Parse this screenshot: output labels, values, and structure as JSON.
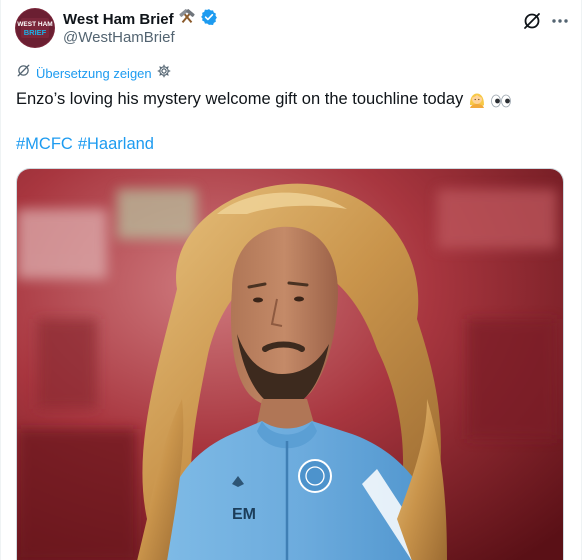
{
  "account": {
    "display_name": "West Ham Brief",
    "handle": "@WestHamBrief",
    "name_emoji": "hammers-icon",
    "verified_badge": "verified-icon",
    "avatar_text_top": "WEST HAM",
    "avatar_text_bottom": "BRIEF",
    "avatar_color": "#7a263a"
  },
  "translation": {
    "label": "Übersetzung zeigen"
  },
  "tweet": {
    "text": "Enzo’s loving his mystery welcome gift on the touchline today",
    "emojis": [
      "person-blond-hair-icon",
      "eyes-icon"
    ],
    "hashtags": [
      "#MCFC",
      "#Haarland"
    ]
  },
  "media": {
    "kit_initials": "EM",
    "kit_color": "#6cabdd"
  },
  "colors": {
    "link": "#1d9bf0",
    "text": "#0f1419",
    "secondary": "#536471",
    "verified": "#1d9bf0"
  }
}
